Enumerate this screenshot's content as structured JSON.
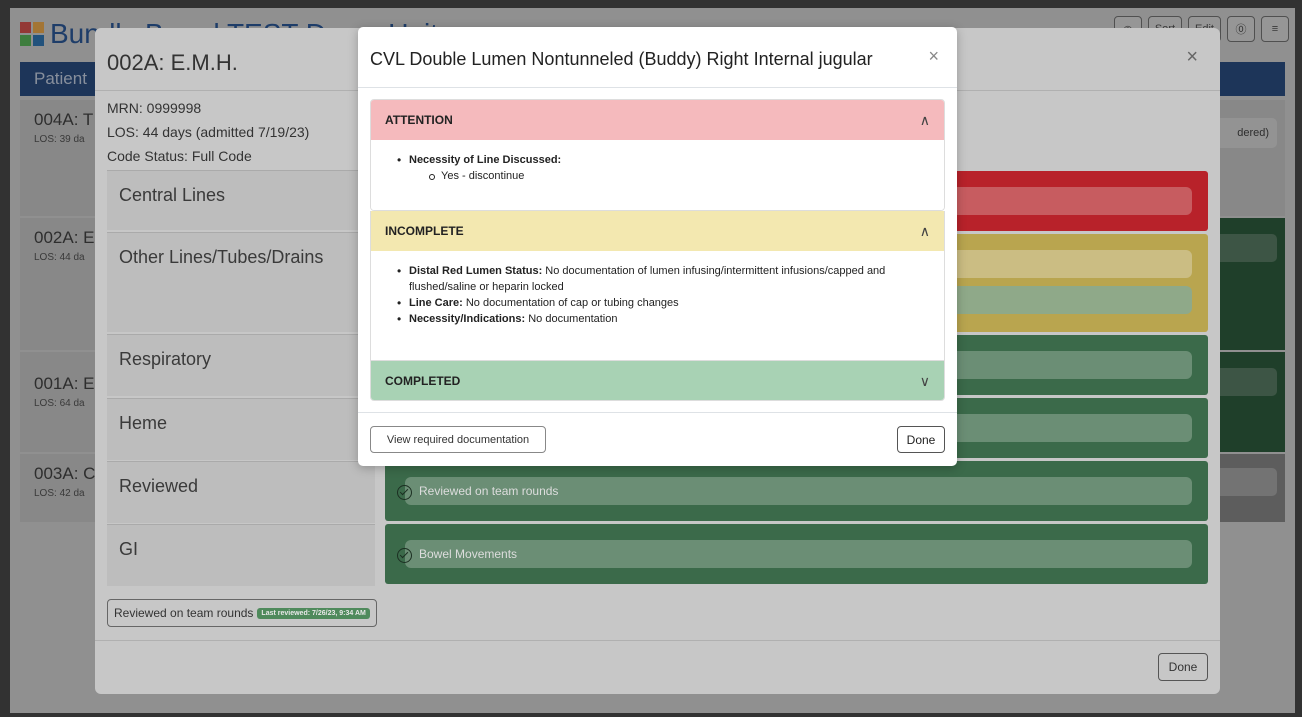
{
  "app": {
    "title": "Bundle Board TEST Demo Unit",
    "header_buttons": [
      "◉",
      "Sort",
      "Edit",
      "⓪",
      "≡"
    ],
    "bar_label": "Patient"
  },
  "background_patients": [
    {
      "name": "004A: T",
      "los": "LOS: 39 da"
    },
    {
      "name": "002A: E",
      "los": "LOS: 44 da"
    },
    {
      "name": "001A: E",
      "los": "LOS: 64 da"
    },
    {
      "name": "003A: C",
      "los": "LOS: 42 da"
    }
  ],
  "background_right": {
    "ordered_label": "dered)"
  },
  "patient_modal": {
    "title": "002A: E.M.H.",
    "close": "×",
    "mrn": "MRN: 0999998",
    "los": "LOS: 44 days (admitted 7/19/23)",
    "code_status": "Code Status: Full Code",
    "categories": [
      {
        "label": "Central Lines"
      },
      {
        "label": "Other Lines/Tubes/Drains"
      },
      {
        "label": "Respiratory"
      },
      {
        "label": "Heme"
      },
      {
        "label": "Reviewed",
        "item": "Reviewed on team rounds"
      },
      {
        "label": "GI",
        "item": "Bowel Movements"
      }
    ],
    "reviewed_button": "Reviewed on team rounds",
    "last_reviewed_badge": "Last reviewed: 7/26/23, 9:34 AM",
    "done": "Done"
  },
  "dialog": {
    "title": "CVL Double Lumen Nontunneled (Buddy) Right Internal jugular",
    "close": "×",
    "sections": [
      {
        "label": "ATTENTION",
        "expanded": true,
        "color": "#f5babd",
        "items": [
          {
            "key": "Necessity of Line Discussed:",
            "text": "",
            "sub": [
              "Yes - discontinue"
            ]
          }
        ]
      },
      {
        "label": "INCOMPLETE",
        "expanded": true,
        "color": "#f3e8b0",
        "items": [
          {
            "key": "Distal Red Lumen Status:",
            "text": " No documentation of lumen infusing/intermittent infusions/capped and flushed/saline or heparin locked"
          },
          {
            "key": "Line Care:",
            "text": " No documentation of cap or tubing changes"
          },
          {
            "key": "Necessity/Indications:",
            "text": " No documentation"
          }
        ]
      },
      {
        "label": "COMPLETED",
        "expanded": false,
        "color": "#a8d2b4",
        "items": []
      }
    ],
    "chevron_up": "∧",
    "chevron_down": "∨",
    "view_required": "View required documentation",
    "done": "Done"
  }
}
